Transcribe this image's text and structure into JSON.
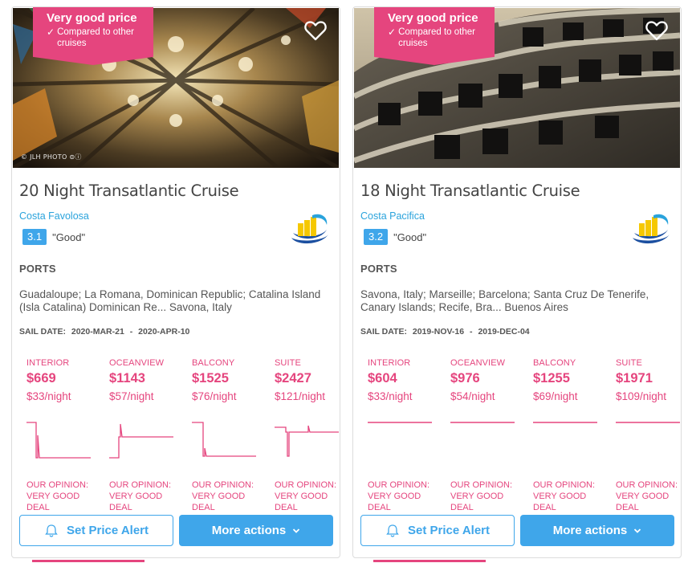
{
  "colors": {
    "accent_pink": "#e5457e",
    "accent_blue": "#3fa6ea",
    "link_blue": "#2aa3dc"
  },
  "cards": [
    {
      "badge": {
        "title": "Very good price",
        "check": "✓",
        "subtitle": "Compared to other cruises"
      },
      "photo_credit": "© JLH PHOTO ⊜ⓘ",
      "title": "20 Night Transatlantic Cruise",
      "ship": "Costa Favolosa",
      "rating": "3.1",
      "rating_text": "\"Good\"",
      "ports_label": "PORTS",
      "ports": "Guadaloupe; La Romana, Dominican Republic; Catalina Island (Isla Catalina) Dominican Re... Savona, Italy",
      "sail_label": "SAIL DATE:",
      "sail_start": "2020-MAR-21",
      "sail_sep": "-",
      "sail_end": "2020-APR-10",
      "cabins": [
        {
          "name": "INTERIOR",
          "price": "$669",
          "per_night": "$33/night",
          "opinion": "OUR OPINION: VERY GOOD DEAL"
        },
        {
          "name": "OCEANVIEW",
          "price": "$1143",
          "per_night": "$57/night",
          "opinion": "OUR OPINION: VERY GOOD DEAL"
        },
        {
          "name": "BALCONY",
          "price": "$1525",
          "per_night": "$76/night",
          "opinion": "OUR OPINION: VERY GOOD DEAL"
        },
        {
          "name": "SUITE",
          "price": "$2427",
          "per_night": "$121/night",
          "opinion": "OUR OPINION: VERY GOOD DEAL"
        }
      ],
      "alert_label": "Set Price Alert",
      "more_label": "More actions"
    },
    {
      "badge": {
        "title": "Very good price",
        "check": "✓",
        "subtitle": "Compared to other cruises"
      },
      "photo_credit": "",
      "title": "18 Night Transatlantic Cruise",
      "ship": "Costa Pacifica",
      "rating": "3.2",
      "rating_text": "\"Good\"",
      "ports_label": "PORTS",
      "ports": "Savona, Italy; Marseille; Barcelona; Santa Cruz De Tenerife, Canary Islands; Recife, Bra... Buenos Aires",
      "sail_label": "SAIL DATE:",
      "sail_start": "2019-NOV-16",
      "sail_sep": "-",
      "sail_end": "2019-DEC-04",
      "cabins": [
        {
          "name": "INTERIOR",
          "price": "$604",
          "per_night": "$33/night",
          "opinion": "OUR OPINION: VERY GOOD DEAL"
        },
        {
          "name": "OCEANVIEW",
          "price": "$976",
          "per_night": "$54/night",
          "opinion": "OUR OPINION: VERY GOOD DEAL"
        },
        {
          "name": "BALCONY",
          "price": "$1255",
          "per_night": "$69/night",
          "opinion": "OUR OPINION: VERY GOOD DEAL"
        },
        {
          "name": "SUITE",
          "price": "$1971",
          "per_night": "$109/night",
          "opinion": "OUR OPINION: VERY GOOD DEAL"
        }
      ],
      "alert_label": "Set Price Alert",
      "more_label": "More actions"
    }
  ]
}
